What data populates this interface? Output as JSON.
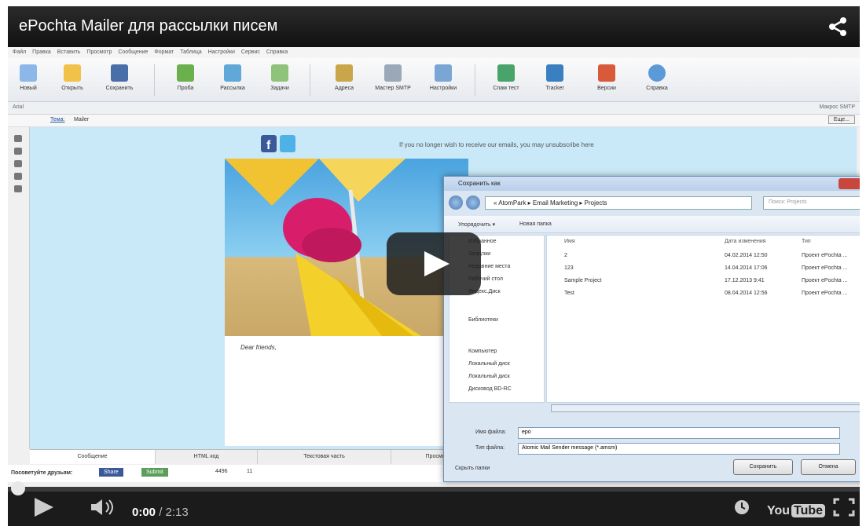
{
  "video": {
    "title": "ePochta Mailer для рассылки писем",
    "icons": [
      "share-icon",
      "play-icon",
      "volume-icon",
      "clock-icon",
      "fullscreen-icon"
    ],
    "time_current": "0:00",
    "time_total": "/ 2:13",
    "brand_left": "You",
    "brand_right": "Tube"
  },
  "app": {
    "menu": [
      "Файл",
      "Правка",
      "Вставить",
      "Просмотр",
      "Сообщение",
      "Формат",
      "Таблица",
      "Настройки",
      "Сервис",
      "Справка"
    ],
    "ribbon": [
      "Новый",
      "Открыть",
      "Сохранить",
      "Проба",
      "Рассылка",
      "Задачи",
      "Адреса",
      "Мастер SMTP",
      "Настройки",
      "Спам тест",
      "Tracker",
      "Версии",
      "Справка"
    ],
    "font_name": "Arial",
    "right_label": "Макрос SMTP",
    "subject_label": "Тема:",
    "subject_value": "Mailer",
    "right_button": "Еще...",
    "unsubscribe": "If you no longer wish to receive our emails, you may unsubscribe here",
    "dear": "Dear friends,",
    "tabs": [
      "Сообщение",
      "HTML код",
      "Текстовая часть",
      "Просмотр"
    ],
    "share_label": "Посоветуйте друзьям:",
    "share_buttons": [
      "Share",
      "Submit",
      "4496",
      "11"
    ]
  },
  "dialog": {
    "title": "Сохранить как",
    "breadcrumb": "« AtomPark  ▸  Email Marketing  ▸  Projects",
    "search_placeholder": "Поиск: Projects",
    "organize": "Упорядочить ▾",
    "new_folder": "Новая папка",
    "nav": [
      "Избранное",
      "Загрузки",
      "Недавние места",
      "Рабочий стол",
      "Яндекс.Диск",
      "Библиотеки",
      "Компьютер",
      "Локальный диск",
      "Локальный диск",
      "Дисковод BD-RC"
    ],
    "columns": {
      "name": "Имя",
      "date": "Дата изменения",
      "type": "Тип"
    },
    "files": [
      {
        "name": "2",
        "date": "04.02.2014 12:50",
        "type": "Проект ePochta ..."
      },
      {
        "name": "123",
        "date": "14.04.2014 17:06",
        "type": "Проект ePochta ..."
      },
      {
        "name": "Sample Project",
        "date": "17.12.2013 9:41",
        "type": "Проект ePochta ..."
      },
      {
        "name": "Test",
        "date": "08.04.2014 12:56",
        "type": "Проект ePochta ..."
      }
    ],
    "filename_label": "Имя файла:",
    "filename_value": "epo",
    "filetype_label": "Тип файла:",
    "filetype_value": "Atomic Mail Sender message (*.amsm)",
    "hide_folders": "Скрыть папки",
    "save_button": "Сохранить",
    "cancel_button": "Отмена"
  }
}
